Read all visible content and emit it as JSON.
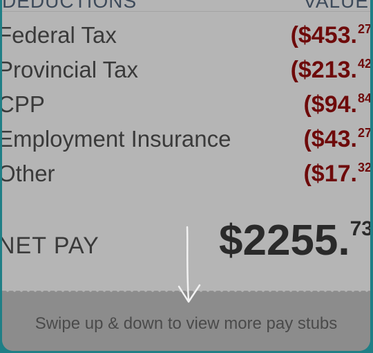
{
  "header": {
    "label": "DEDUCTIONS",
    "value_label": "VALUE"
  },
  "deductions": [
    {
      "label": "Federal Tax",
      "amount_main": "($453.",
      "amount_cents": "27"
    },
    {
      "label": "Provincial Tax",
      "amount_main": "($213.",
      "amount_cents": "42"
    },
    {
      "label": "CPP",
      "amount_main": "($94.",
      "amount_cents": "84"
    },
    {
      "label": "Employment Insurance",
      "amount_main": "($43.",
      "amount_cents": "27"
    },
    {
      "label": "Other",
      "amount_main": "($17.",
      "amount_cents": "32"
    }
  ],
  "net_pay": {
    "label": "NET PAY",
    "amount_main": "$2255.",
    "amount_cents": "73"
  },
  "footer": {
    "hint": "Swipe up & down to view more pay stubs"
  },
  "colors": {
    "frame": "#1f7f86",
    "negative_amount": "#6e0a0a",
    "paper": "#b5b5b5",
    "footer": "#8c8c8c"
  }
}
